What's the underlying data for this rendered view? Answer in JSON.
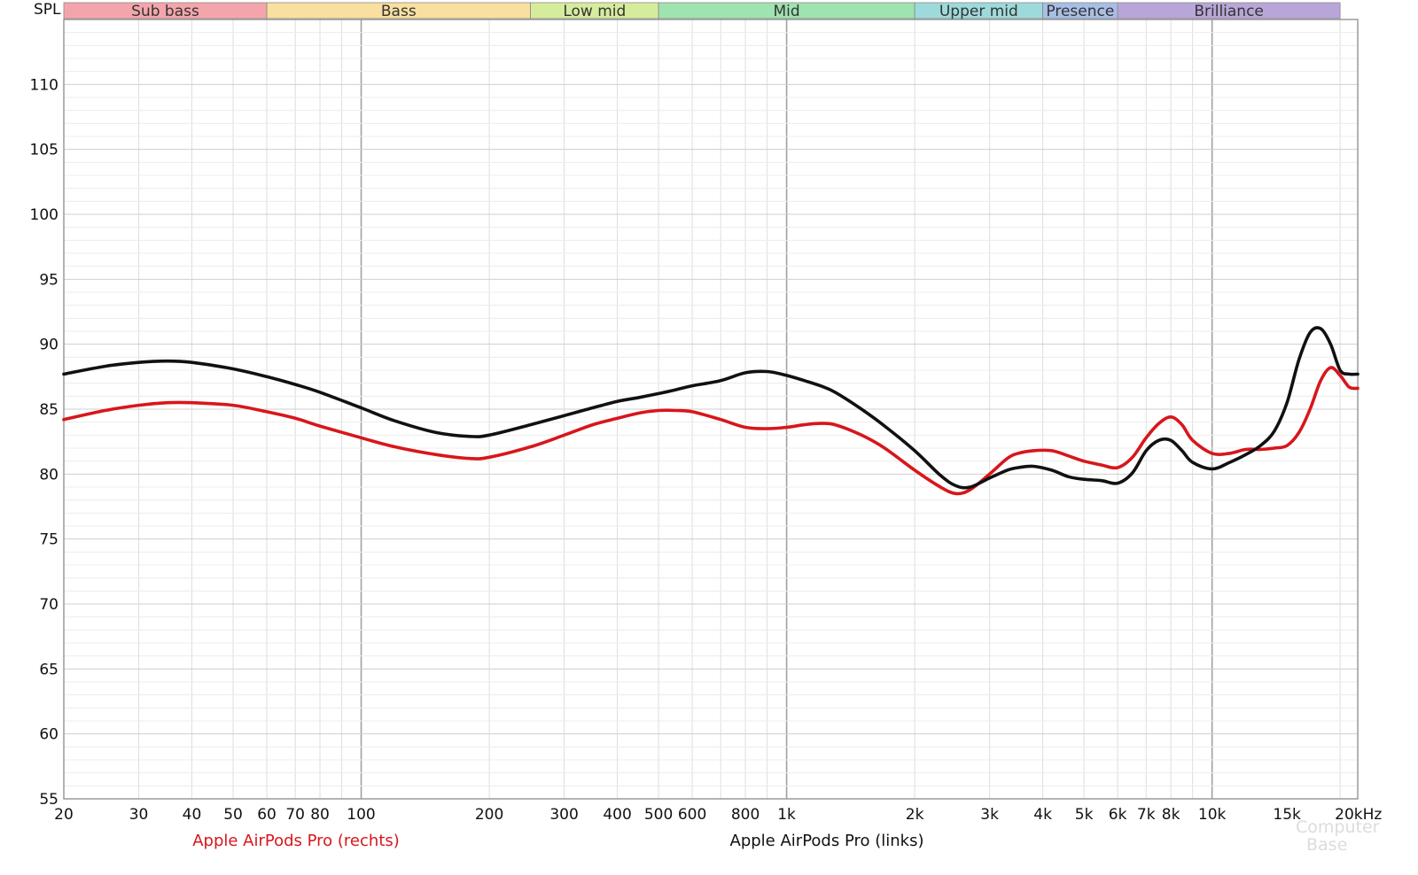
{
  "chart_data": {
    "type": "line",
    "title": "",
    "xlabel": "",
    "ylabel": "SPL",
    "xscale": "log",
    "xlim": [
      20,
      22000
    ],
    "ylim": [
      55,
      115
    ],
    "grid": true,
    "legend_position": "bottom",
    "x_ticks": [
      {
        "value": 20,
        "label": "20"
      },
      {
        "value": 30,
        "label": "30"
      },
      {
        "value": 40,
        "label": "40"
      },
      {
        "value": 50,
        "label": "50"
      },
      {
        "value": 60,
        "label": "60"
      },
      {
        "value": 70,
        "label": "70"
      },
      {
        "value": 80,
        "label": "80"
      },
      {
        "value": 100,
        "label": "100"
      },
      {
        "value": 200,
        "label": "200"
      },
      {
        "value": 300,
        "label": "300"
      },
      {
        "value": 400,
        "label": "400"
      },
      {
        "value": 500,
        "label": "500"
      },
      {
        "value": 600,
        "label": "600"
      },
      {
        "value": 800,
        "label": "800"
      },
      {
        "value": 1000,
        "label": "1k"
      },
      {
        "value": 2000,
        "label": "2k"
      },
      {
        "value": 3000,
        "label": "3k"
      },
      {
        "value": 4000,
        "label": "4k"
      },
      {
        "value": 5000,
        "label": "5k"
      },
      {
        "value": 6000,
        "label": "6k"
      },
      {
        "value": 7000,
        "label": "7k"
      },
      {
        "value": 8000,
        "label": "8k"
      },
      {
        "value": 10000,
        "label": "10k"
      },
      {
        "value": 15000,
        "label": "15k"
      },
      {
        "value": 20000,
        "label": "20kHz"
      }
    ],
    "y_ticks": [
      55,
      60,
      65,
      70,
      75,
      80,
      85,
      90,
      95,
      100,
      105,
      110
    ],
    "bands": [
      {
        "name": "Sub bass",
        "from": 20,
        "to": 60,
        "color": "#f4a5ab"
      },
      {
        "name": "Bass",
        "from": 60,
        "to": 250,
        "color": "#f9dfa0"
      },
      {
        "name": "Low mid",
        "from": 250,
        "to": 500,
        "color": "#d6ec9d"
      },
      {
        "name": "Mid",
        "from": 500,
        "to": 2000,
        "color": "#9fe3b0"
      },
      {
        "name": "Upper mid",
        "from": 2000,
        "to": 4000,
        "color": "#9edadb"
      },
      {
        "name": "Presence",
        "from": 4000,
        "to": 6000,
        "color": "#a9bee6"
      },
      {
        "name": "Brilliance",
        "from": 6000,
        "to": 20000,
        "color": "#b8a6d8"
      }
    ],
    "series": [
      {
        "name": "Apple AirPods Pro (rechts)",
        "color": "#d8161b",
        "x": [
          20,
          25,
          30,
          35,
          40,
          50,
          60,
          70,
          80,
          100,
          120,
          150,
          180,
          200,
          250,
          300,
          350,
          400,
          450,
          500,
          550,
          600,
          700,
          800,
          900,
          1000,
          1100,
          1200,
          1300,
          1500,
          1700,
          2000,
          2300,
          2500,
          2700,
          3000,
          3300,
          3500,
          3800,
          4200,
          4600,
          5000,
          5500,
          6000,
          6500,
          7000,
          7500,
          8000,
          8500,
          9000,
          10000,
          11000,
          12000,
          13000,
          14000,
          15000,
          16000,
          17000,
          18000,
          19000,
          20000,
          21000,
          22000
        ],
        "y": [
          84.2,
          84.9,
          85.3,
          85.5,
          85.5,
          85.3,
          84.8,
          84.3,
          83.7,
          82.8,
          82.1,
          81.5,
          81.2,
          81.3,
          82.1,
          83.0,
          83.8,
          84.3,
          84.7,
          84.9,
          84.9,
          84.8,
          84.2,
          83.6,
          83.5,
          83.6,
          83.8,
          83.9,
          83.8,
          83.0,
          82.0,
          80.3,
          79.0,
          78.5,
          78.8,
          80.0,
          81.2,
          81.6,
          81.8,
          81.8,
          81.4,
          81.0,
          80.7,
          80.5,
          81.3,
          82.8,
          83.9,
          84.4,
          83.8,
          82.6,
          81.6,
          81.6,
          81.9,
          81.9,
          82.0,
          82.2,
          83.2,
          85.0,
          87.2,
          88.2,
          87.6,
          86.7,
          86.6
        ]
      },
      {
        "name": "Apple AirPods Pro (links)",
        "color": "#111111",
        "x": [
          20,
          25,
          30,
          35,
          40,
          50,
          60,
          70,
          80,
          100,
          120,
          150,
          180,
          200,
          250,
          300,
          350,
          400,
          450,
          500,
          550,
          600,
          700,
          800,
          900,
          1000,
          1100,
          1200,
          1300,
          1500,
          1700,
          2000,
          2300,
          2500,
          2700,
          3000,
          3300,
          3500,
          3800,
          4200,
          4600,
          5000,
          5500,
          6000,
          6500,
          7000,
          7500,
          8000,
          8500,
          9000,
          10000,
          11000,
          12000,
          13000,
          14000,
          15000,
          16000,
          17000,
          18000,
          19000,
          20000,
          21000,
          22000
        ],
        "y": [
          87.7,
          88.3,
          88.6,
          88.7,
          88.6,
          88.1,
          87.5,
          86.9,
          86.3,
          85.1,
          84.1,
          83.2,
          82.9,
          83.0,
          83.8,
          84.5,
          85.1,
          85.6,
          85.9,
          86.2,
          86.5,
          86.8,
          87.2,
          87.8,
          87.9,
          87.6,
          87.2,
          86.8,
          86.3,
          85.0,
          83.7,
          81.8,
          79.9,
          79.1,
          79.0,
          79.7,
          80.3,
          80.5,
          80.6,
          80.3,
          79.8,
          79.6,
          79.5,
          79.3,
          80.1,
          81.8,
          82.6,
          82.6,
          81.8,
          80.9,
          80.4,
          80.9,
          81.5,
          82.2,
          83.3,
          85.5,
          88.8,
          90.9,
          91.2,
          90.0,
          88.0,
          87.7,
          87.7
        ]
      }
    ],
    "legend": [
      {
        "label": "Apple AirPods Pro (rechts)",
        "color": "#d8161b"
      },
      {
        "label": "Apple AirPods Pro (links)",
        "color": "#111111"
      }
    ],
    "watermark": [
      "Computer",
      "Base"
    ]
  }
}
